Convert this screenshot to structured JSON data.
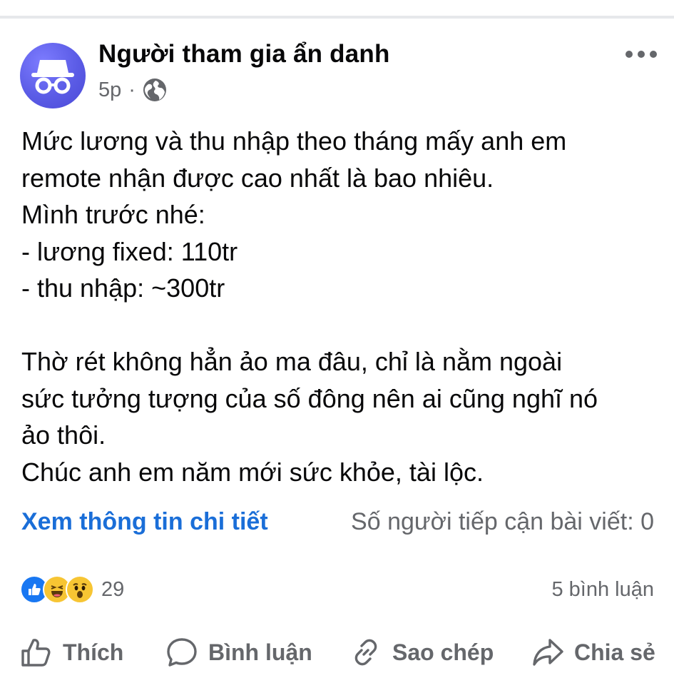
{
  "post": {
    "author": "Người tham gia ẩn danh",
    "time": "5p",
    "separator": "·",
    "privacy_icon": "globe-icon",
    "more_icon": "more-dots-icon",
    "body": "Mức lương và thu nhập theo tháng mấy anh em\nremote nhận được cao nhất là bao nhiêu.\nMình trước nhé:\n- lương fixed: 110tr\n- thu nhập: ~300tr\n\nThờ rét không hẳn ảo ma đâu, chỉ là nằm ngoài\nsức tưởng tượng của số đông nên ai cũng nghĩ nó\nảo thôi.\nChúc anh em năm mới sức khỏe, tài lộc."
  },
  "insights": {
    "details_link": "Xem thông tin chi tiết",
    "reach": "Số người tiếp cận bài viết: 0"
  },
  "engagement": {
    "reaction_icons": [
      "like-icon",
      "haha-icon",
      "wow-icon"
    ],
    "reaction_count": "29",
    "comment_count": "5 bình luận"
  },
  "actions": {
    "like": "Thích",
    "comment": "Bình luận",
    "copy": "Sao chép",
    "share": "Chia sẻ"
  },
  "colors": {
    "accent": "#1a6ed8",
    "secondary_text": "#65676b",
    "avatar": "#5b5ce6"
  }
}
